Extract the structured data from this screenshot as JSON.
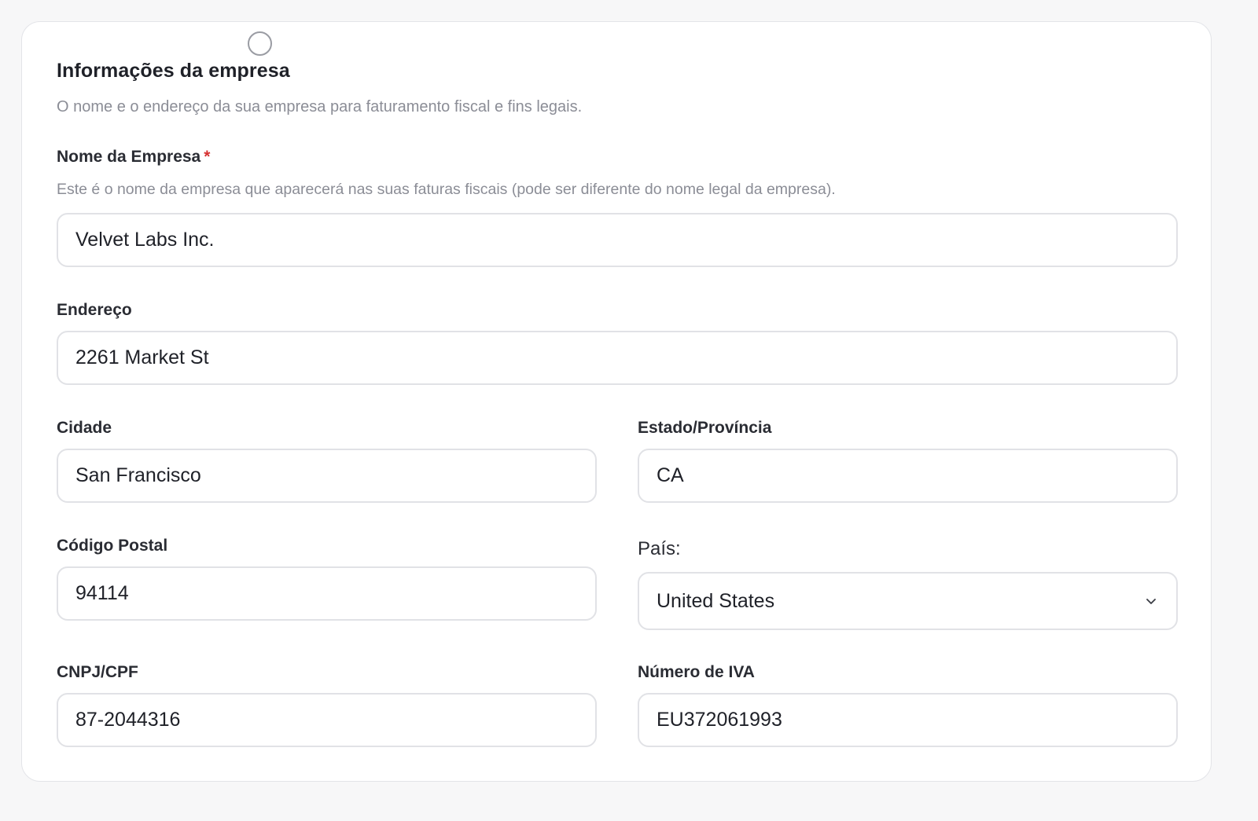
{
  "section": {
    "title": "Informações da empresa",
    "description": "O nome e o endereço da sua empresa para faturamento fiscal e fins legais."
  },
  "fields": {
    "company_name": {
      "label": "Nome da Empresa",
      "required_mark": "*",
      "help": "Este é o nome da empresa que aparecerá nas suas faturas fiscais (pode ser diferente do nome legal da empresa).",
      "value": "Velvet Labs Inc."
    },
    "address": {
      "label": "Endereço",
      "value": "2261 Market St"
    },
    "city": {
      "label": "Cidade",
      "value": "San Francisco"
    },
    "state": {
      "label": "Estado/Província",
      "value": "CA"
    },
    "postal_code": {
      "label": "Código Postal",
      "value": "94114"
    },
    "country": {
      "label": "País:",
      "value": "United States"
    },
    "tax_id": {
      "label": "CNPJ/CPF",
      "value": "87-2044316"
    },
    "vat": {
      "label": "Número de IVA",
      "value": "EU372061993"
    }
  },
  "icons": {
    "select_chevron": "chevron-down-icon",
    "marker": "circle-marker-icon"
  },
  "colors": {
    "required": "#d63232",
    "border": "#e1e2e6",
    "muted_text": "#8b8d96"
  }
}
